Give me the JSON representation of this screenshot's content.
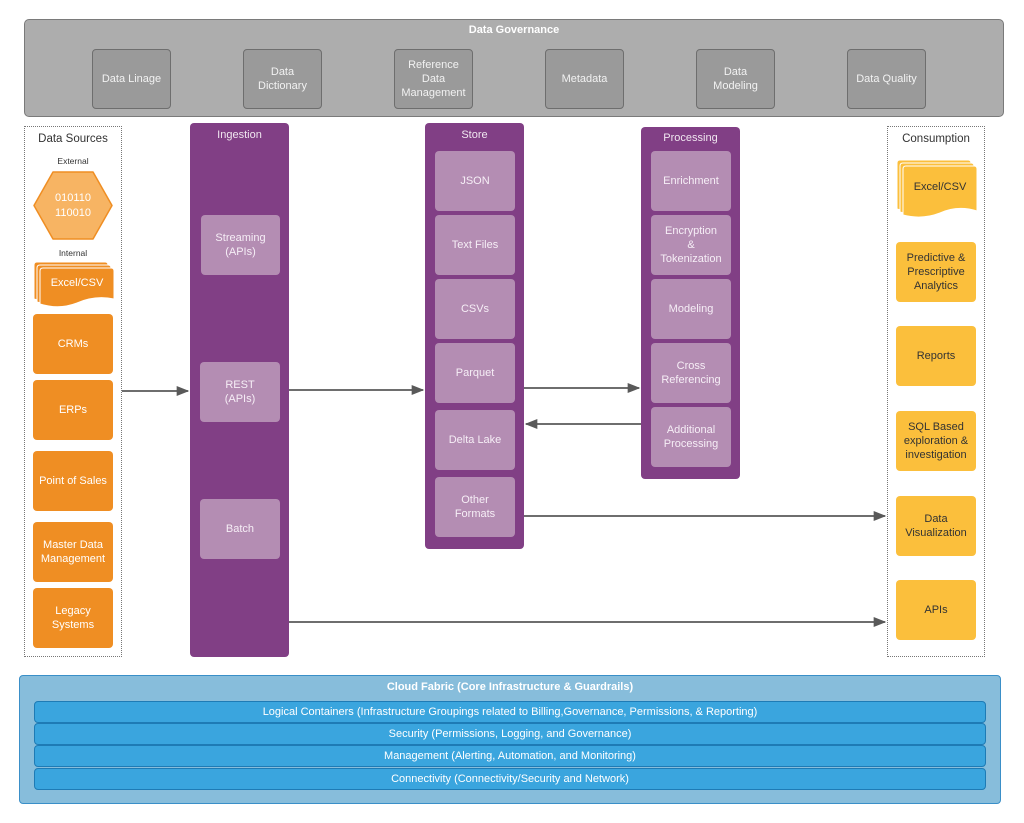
{
  "governance": {
    "title": "Data Governance",
    "items": [
      "Data Linage",
      "Data\nDictionary",
      "Reference\nData\nManagement",
      "Metadata",
      "Data\nModeling",
      "Data Quality"
    ]
  },
  "sources": {
    "title": "Data Sources",
    "external_label": "External",
    "external_item": "010110\n110010",
    "internal_label": "Internal",
    "document_item": "Excel/CSV",
    "items": [
      "CRMs",
      "ERPs",
      "Point of Sales",
      "Master Data\nManagement",
      "Legacy\nSystems"
    ]
  },
  "ingestion": {
    "title": "Ingestion",
    "items": [
      "Streaming\n(APIs)",
      "REST\n(APIs)",
      "Batch"
    ]
  },
  "store": {
    "title": "Store",
    "items": [
      "JSON",
      "Text Files",
      "CSVs",
      "Parquet",
      "Delta Lake",
      "Other\nFormats"
    ]
  },
  "processing": {
    "title": "Processing",
    "items": [
      "Enrichment",
      "Encryption\n&\nTokenization",
      "Modeling",
      "Cross\nReferencing",
      "Additional\nProcessing"
    ]
  },
  "consumption": {
    "title": "Consumption",
    "document_item": "Excel/CSV",
    "items": [
      "Predictive &\nPrescriptive\nAnalytics",
      "Reports",
      "SQL Based\nexploration  &\ninvestigation",
      "Data\nVisualization",
      "APIs"
    ]
  },
  "cloud_fabric": {
    "title": "Cloud Fabric (Core Infrastructure & Guardrails)",
    "rows": [
      "Logical Containers (Infrastructure Groupings related to Billing,Governance, Permissions, & Reporting)",
      "Security (Permissions, Logging, and Governance)",
      "Management (Alerting, Automation, and Monitoring)",
      "Connectivity (Connectivity/Security and Network)"
    ]
  },
  "colors": {
    "governance_bg": "#adadad",
    "source_orange": "#ef8e23",
    "hexagon_orange": "#f7b463",
    "consumption_yellow": "#fbbf3c",
    "purple": "#813f85",
    "purple_box": "#b48db3",
    "cloud_bg": "#87bddb",
    "cloud_row": "#3aa5de",
    "arrow": "#595959"
  }
}
